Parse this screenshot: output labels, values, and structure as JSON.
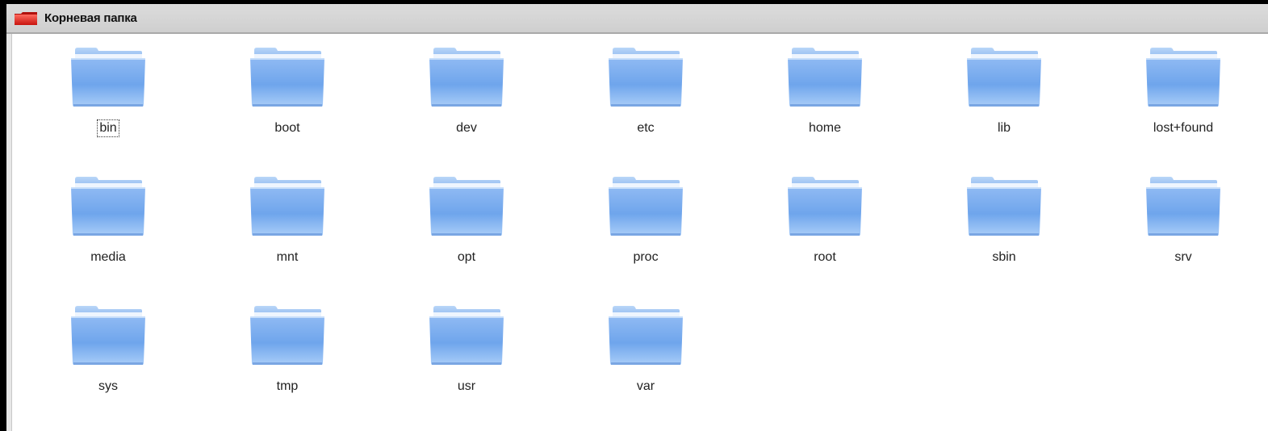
{
  "window": {
    "title": "Корневая папка",
    "title_icon": "red-folder-icon"
  },
  "colors": {
    "titlebar_bg": "#d4d4d4",
    "folder_blue": "#7aaef0",
    "folder_title_icon": "#e0221c"
  },
  "items": [
    {
      "label": "bin",
      "icon": "folder-icon",
      "focused": true
    },
    {
      "label": "boot",
      "icon": "folder-icon"
    },
    {
      "label": "dev",
      "icon": "folder-icon"
    },
    {
      "label": "etc",
      "icon": "folder-icon"
    },
    {
      "label": "home",
      "icon": "folder-icon"
    },
    {
      "label": "lib",
      "icon": "folder-icon"
    },
    {
      "label": "lost+found",
      "icon": "folder-icon"
    },
    {
      "label": "media",
      "icon": "folder-icon"
    },
    {
      "label": "mnt",
      "icon": "folder-icon"
    },
    {
      "label": "opt",
      "icon": "folder-icon"
    },
    {
      "label": "proc",
      "icon": "folder-icon"
    },
    {
      "label": "root",
      "icon": "folder-icon"
    },
    {
      "label": "sbin",
      "icon": "folder-icon"
    },
    {
      "label": "srv",
      "icon": "folder-icon"
    },
    {
      "label": "sys",
      "icon": "folder-icon"
    },
    {
      "label": "tmp",
      "icon": "folder-icon"
    },
    {
      "label": "usr",
      "icon": "folder-icon"
    },
    {
      "label": "var",
      "icon": "folder-icon"
    }
  ]
}
